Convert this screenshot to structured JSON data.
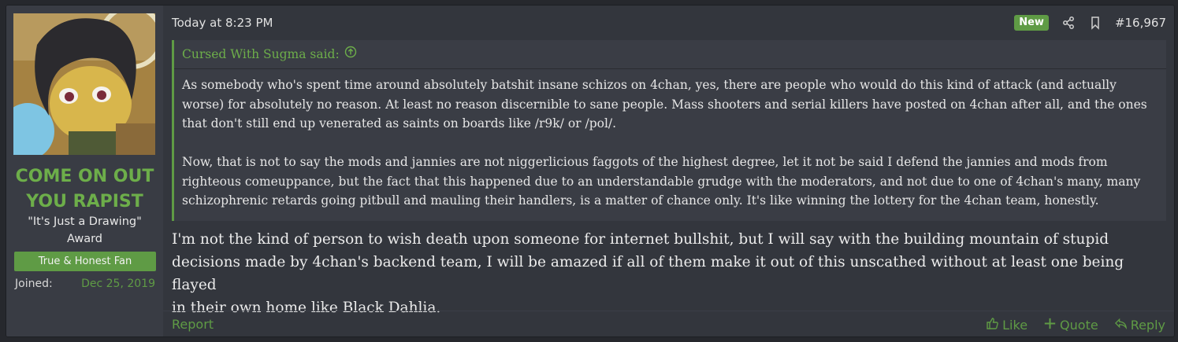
{
  "user": {
    "name_line1": "COME ON OUT",
    "name_line2": "YOU RAPIST",
    "title_line1": "\"It's Just a Drawing\"",
    "title_line2": "Award",
    "banner": "True & Honest Fan",
    "joined_label": "Joined:",
    "joined_value": "Dec 25, 2019"
  },
  "post": {
    "date": "Today at 8:23 PM",
    "new_badge": "New",
    "number": "#16,967",
    "quote": {
      "author": "Cursed With Sugma said:",
      "paragraph1_lines": [
        "As somebody who's spent time around absolutely batshit insane schizos on 4chan, yes, there are people who would do this kind of attack (and actually",
        "worse) for absolutely no reason. At least no reason discernible to sane people. Mass shooters and serial killers have posted on 4chan after all, and the ones",
        "that don't still end up venerated as saints on boards like /r9k/ or /pol/."
      ],
      "paragraph2_lines": [
        "Now, that is not to say the mods and jannies are not niggerlicious faggots of the highest degree, let it not be said I defend the jannies and mods from",
        "righteous comeuppance, but the fact that this happened due to an understandable grudge with the moderators, and not due to one of 4chan's many, many",
        "schizophrenic retards going pitbull and mauling their handlers, is a matter of chance only. It's like winning the lottery for the 4chan team, honestly."
      ]
    },
    "message_lines": [
      "I'm not the kind of person to wish death upon someone for internet bullshit, but I will say with the building mountain of stupid",
      "decisions made by 4chan's backend team, I will be amazed if all of them make it out of this unscathed without at least one being flayed",
      "in their own home like Black Dahlia."
    ]
  },
  "footer": {
    "report": "Report",
    "like": "Like",
    "quote": "Quote",
    "reply": "Reply"
  },
  "colors": {
    "accent": "#5f9b45",
    "background": "#33363d",
    "sidebar": "#393c44"
  },
  "icons": [
    "share-icon",
    "bookmark-icon",
    "arrow-up-circle-icon",
    "thumbs-up-icon",
    "plus-icon",
    "reply-icon"
  ]
}
